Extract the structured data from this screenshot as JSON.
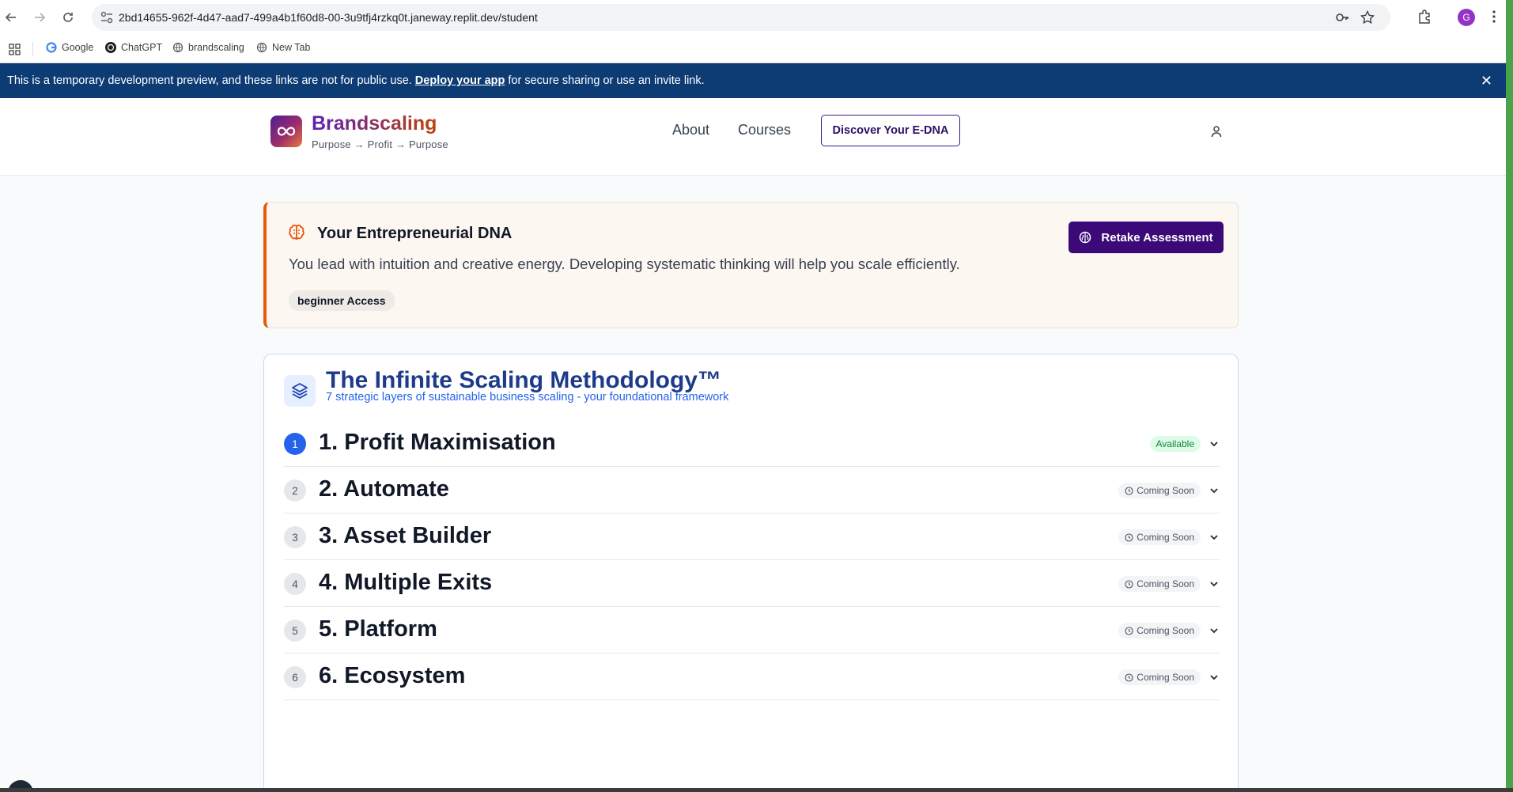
{
  "browser": {
    "url": "2bd14655-962f-4d47-aad7-499a4b1f60d8-00-3u9tfj4rzkq0t.janeway.replit.dev/student",
    "bookmarks": [
      {
        "label": "Google",
        "icon": "google-icon"
      },
      {
        "label": "ChatGPT",
        "icon": "chatgpt-icon"
      },
      {
        "label": "brandscaling",
        "icon": "globe-icon"
      },
      {
        "label": "New Tab",
        "icon": "globe-icon"
      }
    ],
    "profile_initial": "G"
  },
  "dev_banner": {
    "text_before": "This is a temporary development preview, and these links are not for public use.",
    "link": "Deploy your app",
    "text_after": "for secure sharing or use an invite link.",
    "close": "✕"
  },
  "header": {
    "brand": "Brandscaling",
    "tagline": "Purpose → Profit → Purpose",
    "nav": [
      "About",
      "Courses"
    ],
    "cta": "Discover Your E-DNA"
  },
  "dna_card": {
    "title": "Your Entrepreneurial DNA",
    "description": "You lead with intuition and creative energy. Developing systematic thinking will help you scale efficiently.",
    "badge": "beginner Access",
    "button": "Retake Assessment"
  },
  "methodology": {
    "title": "The Infinite Scaling Methodology™",
    "subtitle": "7 strategic layers of sustainable business scaling - your foundational framework",
    "layers": [
      {
        "num": "1",
        "title": "1. Profit Maximisation",
        "status": "Available"
      },
      {
        "num": "2",
        "title": "2. Automate",
        "status": "Coming Soon"
      },
      {
        "num": "3",
        "title": "3. Asset Builder",
        "status": "Coming Soon"
      },
      {
        "num": "4",
        "title": "4. Multiple Exits",
        "status": "Coming Soon"
      },
      {
        "num": "5",
        "title": "5. Platform",
        "status": "Coming Soon"
      },
      {
        "num": "6",
        "title": "6. Ecosystem",
        "status": "Coming Soon"
      }
    ]
  },
  "colors": {
    "banner": "#0d3b73",
    "primary_purple": "#3b0a78",
    "accent_orange": "#ea580c",
    "method_blue": "#1e3a8a",
    "available_green": "#15803d"
  }
}
